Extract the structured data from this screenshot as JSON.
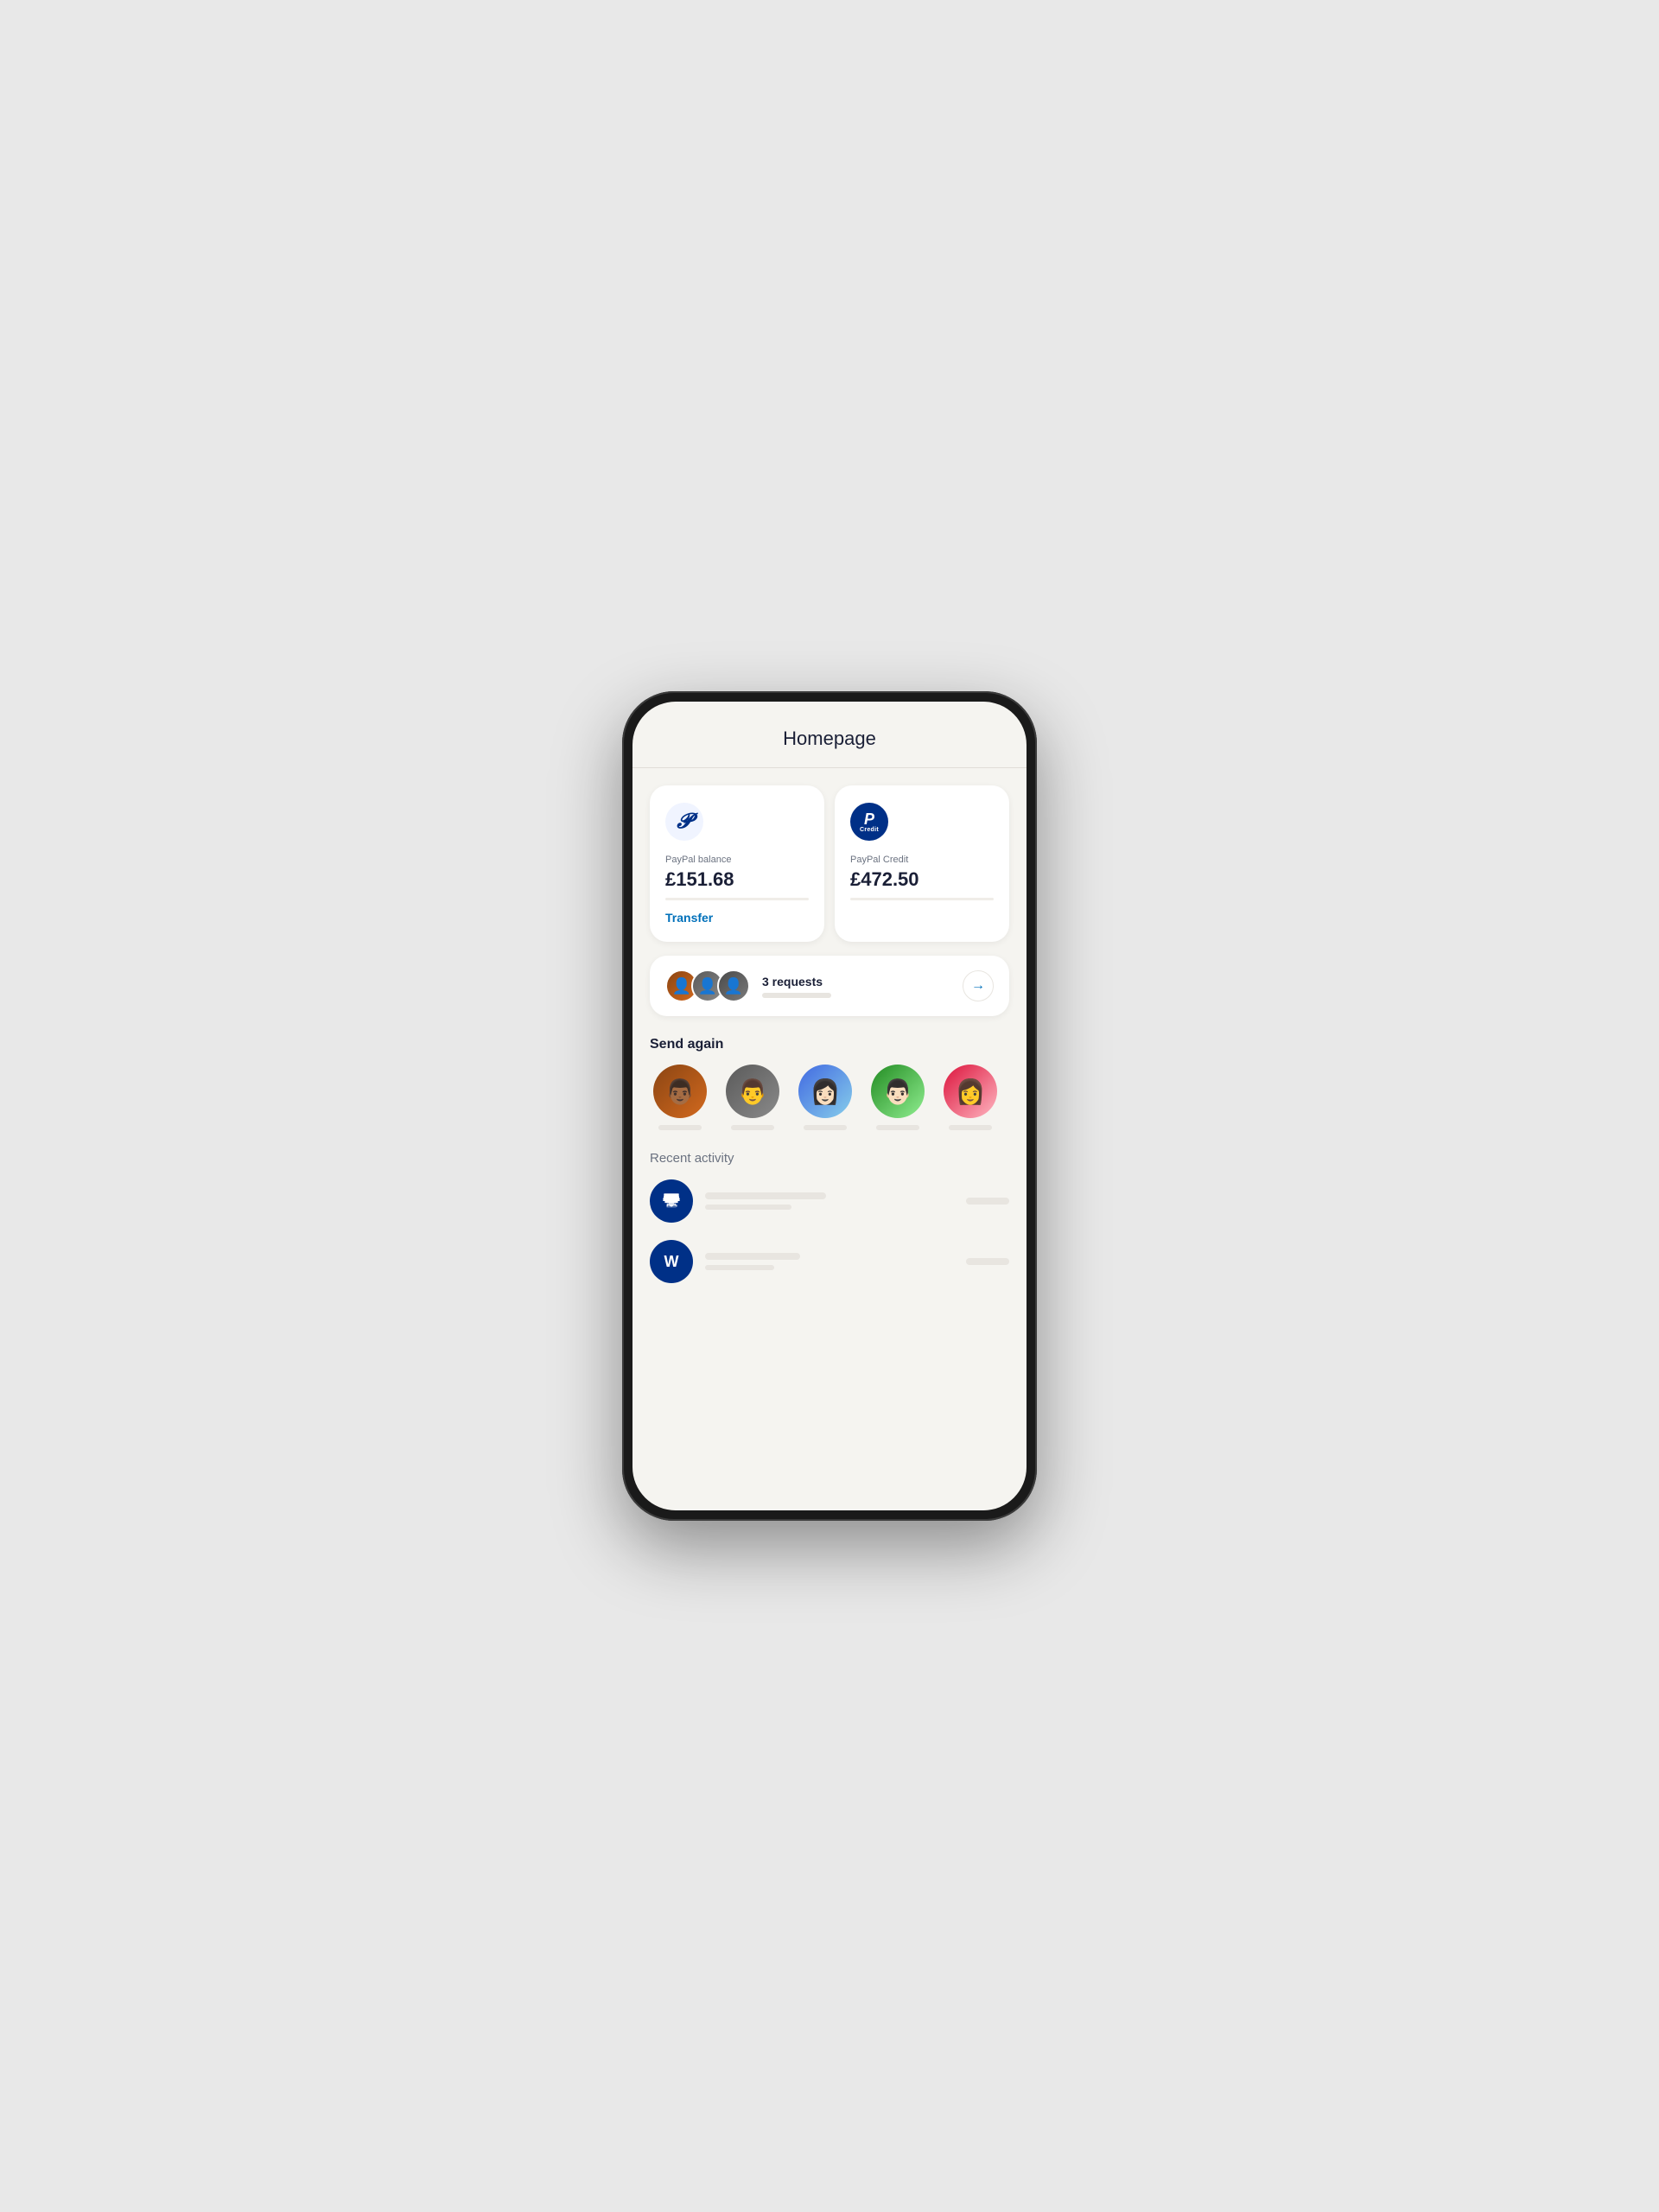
{
  "page": {
    "title": "Homepage"
  },
  "balance_card": {
    "label": "PayPal balance",
    "amount": "£151.68",
    "transfer_label": "Transfer"
  },
  "credit_card": {
    "label": "PayPal Credit",
    "amount": "£472.50",
    "credit_text": "Credit"
  },
  "requests": {
    "label": "3 requests"
  },
  "send_again": {
    "title": "Send again"
  },
  "recent_activity": {
    "title": "Recent activity"
  },
  "icons": {
    "arrow_right": "→",
    "paypal_p": "P",
    "credit_p": "P",
    "store": "🏪",
    "w_letter": "W"
  }
}
